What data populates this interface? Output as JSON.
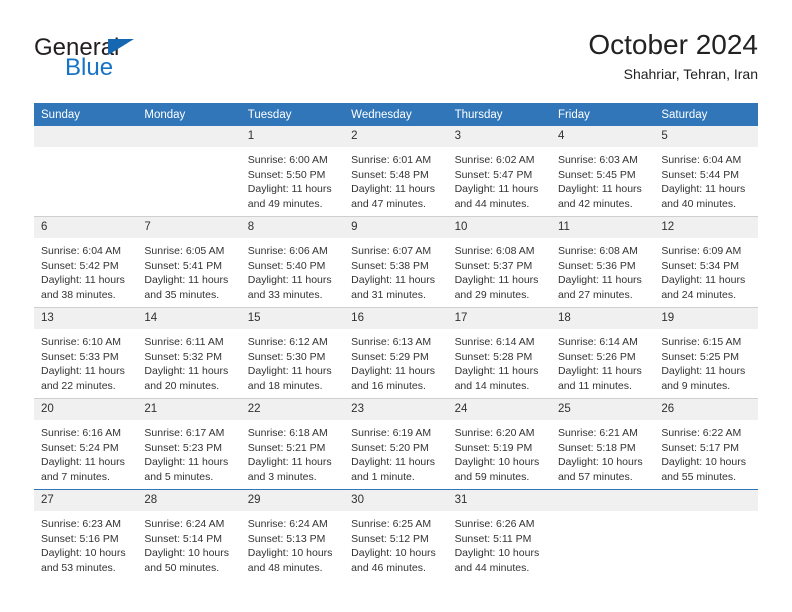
{
  "logo": {
    "word1": "General",
    "word2": "Blue",
    "triangle_color": "#1667b2",
    "word1_color": "#231f20",
    "word2_color": "#1774c4"
  },
  "header": {
    "title": "October 2024",
    "subtitle": "Shahriar, Tehran, Iran"
  },
  "colors": {
    "header_row_bg": "#3076b8",
    "daynum_bg": "#f0f0f0",
    "grid_line": "#cfcfcf",
    "text": "#333333"
  },
  "weekdays": [
    "Sunday",
    "Monday",
    "Tuesday",
    "Wednesday",
    "Thursday",
    "Friday",
    "Saturday"
  ],
  "weeks": [
    [
      {
        "day": "",
        "sunrise": "",
        "sunset": "",
        "daylight": ""
      },
      {
        "day": "",
        "sunrise": "",
        "sunset": "",
        "daylight": ""
      },
      {
        "day": "1",
        "sunrise": "Sunrise: 6:00 AM",
        "sunset": "Sunset: 5:50 PM",
        "daylight": "Daylight: 11 hours and 49 minutes."
      },
      {
        "day": "2",
        "sunrise": "Sunrise: 6:01 AM",
        "sunset": "Sunset: 5:48 PM",
        "daylight": "Daylight: 11 hours and 47 minutes."
      },
      {
        "day": "3",
        "sunrise": "Sunrise: 6:02 AM",
        "sunset": "Sunset: 5:47 PM",
        "daylight": "Daylight: 11 hours and 44 minutes."
      },
      {
        "day": "4",
        "sunrise": "Sunrise: 6:03 AM",
        "sunset": "Sunset: 5:45 PM",
        "daylight": "Daylight: 11 hours and 42 minutes."
      },
      {
        "day": "5",
        "sunrise": "Sunrise: 6:04 AM",
        "sunset": "Sunset: 5:44 PM",
        "daylight": "Daylight: 11 hours and 40 minutes."
      }
    ],
    [
      {
        "day": "6",
        "sunrise": "Sunrise: 6:04 AM",
        "sunset": "Sunset: 5:42 PM",
        "daylight": "Daylight: 11 hours and 38 minutes."
      },
      {
        "day": "7",
        "sunrise": "Sunrise: 6:05 AM",
        "sunset": "Sunset: 5:41 PM",
        "daylight": "Daylight: 11 hours and 35 minutes."
      },
      {
        "day": "8",
        "sunrise": "Sunrise: 6:06 AM",
        "sunset": "Sunset: 5:40 PM",
        "daylight": "Daylight: 11 hours and 33 minutes."
      },
      {
        "day": "9",
        "sunrise": "Sunrise: 6:07 AM",
        "sunset": "Sunset: 5:38 PM",
        "daylight": "Daylight: 11 hours and 31 minutes."
      },
      {
        "day": "10",
        "sunrise": "Sunrise: 6:08 AM",
        "sunset": "Sunset: 5:37 PM",
        "daylight": "Daylight: 11 hours and 29 minutes."
      },
      {
        "day": "11",
        "sunrise": "Sunrise: 6:08 AM",
        "sunset": "Sunset: 5:36 PM",
        "daylight": "Daylight: 11 hours and 27 minutes."
      },
      {
        "day": "12",
        "sunrise": "Sunrise: 6:09 AM",
        "sunset": "Sunset: 5:34 PM",
        "daylight": "Daylight: 11 hours and 24 minutes."
      }
    ],
    [
      {
        "day": "13",
        "sunrise": "Sunrise: 6:10 AM",
        "sunset": "Sunset: 5:33 PM",
        "daylight": "Daylight: 11 hours and 22 minutes."
      },
      {
        "day": "14",
        "sunrise": "Sunrise: 6:11 AM",
        "sunset": "Sunset: 5:32 PM",
        "daylight": "Daylight: 11 hours and 20 minutes."
      },
      {
        "day": "15",
        "sunrise": "Sunrise: 6:12 AM",
        "sunset": "Sunset: 5:30 PM",
        "daylight": "Daylight: 11 hours and 18 minutes."
      },
      {
        "day": "16",
        "sunrise": "Sunrise: 6:13 AM",
        "sunset": "Sunset: 5:29 PM",
        "daylight": "Daylight: 11 hours and 16 minutes."
      },
      {
        "day": "17",
        "sunrise": "Sunrise: 6:14 AM",
        "sunset": "Sunset: 5:28 PM",
        "daylight": "Daylight: 11 hours and 14 minutes."
      },
      {
        "day": "18",
        "sunrise": "Sunrise: 6:14 AM",
        "sunset": "Sunset: 5:26 PM",
        "daylight": "Daylight: 11 hours and 11 minutes."
      },
      {
        "day": "19",
        "sunrise": "Sunrise: 6:15 AM",
        "sunset": "Sunset: 5:25 PM",
        "daylight": "Daylight: 11 hours and 9 minutes."
      }
    ],
    [
      {
        "day": "20",
        "sunrise": "Sunrise: 6:16 AM",
        "sunset": "Sunset: 5:24 PM",
        "daylight": "Daylight: 11 hours and 7 minutes."
      },
      {
        "day": "21",
        "sunrise": "Sunrise: 6:17 AM",
        "sunset": "Sunset: 5:23 PM",
        "daylight": "Daylight: 11 hours and 5 minutes."
      },
      {
        "day": "22",
        "sunrise": "Sunrise: 6:18 AM",
        "sunset": "Sunset: 5:21 PM",
        "daylight": "Daylight: 11 hours and 3 minutes."
      },
      {
        "day": "23",
        "sunrise": "Sunrise: 6:19 AM",
        "sunset": "Sunset: 5:20 PM",
        "daylight": "Daylight: 11 hours and 1 minute."
      },
      {
        "day": "24",
        "sunrise": "Sunrise: 6:20 AM",
        "sunset": "Sunset: 5:19 PM",
        "daylight": "Daylight: 10 hours and 59 minutes."
      },
      {
        "day": "25",
        "sunrise": "Sunrise: 6:21 AM",
        "sunset": "Sunset: 5:18 PM",
        "daylight": "Daylight: 10 hours and 57 minutes."
      },
      {
        "day": "26",
        "sunrise": "Sunrise: 6:22 AM",
        "sunset": "Sunset: 5:17 PM",
        "daylight": "Daylight: 10 hours and 55 minutes."
      }
    ],
    [
      {
        "day": "27",
        "sunrise": "Sunrise: 6:23 AM",
        "sunset": "Sunset: 5:16 PM",
        "daylight": "Daylight: 10 hours and 53 minutes."
      },
      {
        "day": "28",
        "sunrise": "Sunrise: 6:24 AM",
        "sunset": "Sunset: 5:14 PM",
        "daylight": "Daylight: 10 hours and 50 minutes."
      },
      {
        "day": "29",
        "sunrise": "Sunrise: 6:24 AM",
        "sunset": "Sunset: 5:13 PM",
        "daylight": "Daylight: 10 hours and 48 minutes."
      },
      {
        "day": "30",
        "sunrise": "Sunrise: 6:25 AM",
        "sunset": "Sunset: 5:12 PM",
        "daylight": "Daylight: 10 hours and 46 minutes."
      },
      {
        "day": "31",
        "sunrise": "Sunrise: 6:26 AM",
        "sunset": "Sunset: 5:11 PM",
        "daylight": "Daylight: 10 hours and 44 minutes."
      },
      {
        "day": "",
        "sunrise": "",
        "sunset": "",
        "daylight": ""
      },
      {
        "day": "",
        "sunrise": "",
        "sunset": "",
        "daylight": ""
      }
    ]
  ]
}
